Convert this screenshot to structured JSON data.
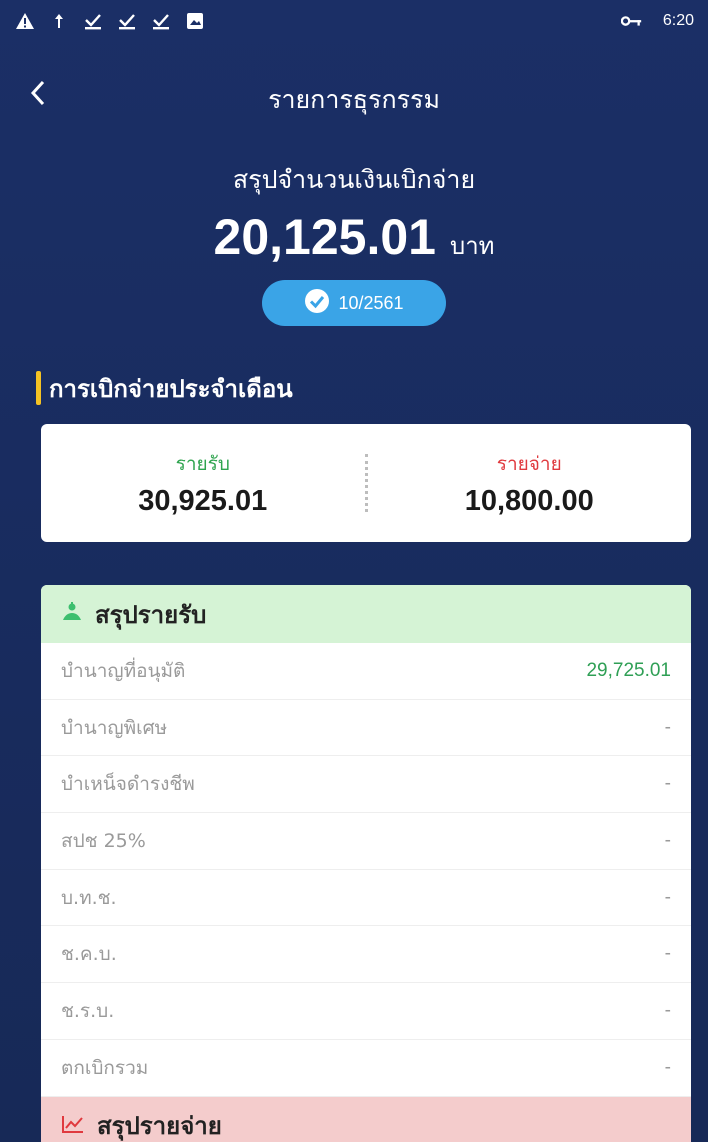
{
  "status_bar": {
    "time": "6:20",
    "icons": [
      "warning-icon",
      "upload-icon",
      "download-done-icon",
      "download-done-icon",
      "download-done-icon",
      "image-icon",
      "vpn-key-icon"
    ]
  },
  "header": {
    "title": "รายการธุรกรรม"
  },
  "summary": {
    "label": "สรุปจำนวนเงินเบิกจ่าย",
    "amount": "20,125.01",
    "unit": "บาท",
    "period": "10/2561"
  },
  "monthly": {
    "title": "การเบิกจ่ายประจำเดือน",
    "income_label": "รายรับ",
    "income_value": "30,925.01",
    "expense_label": "รายจ่าย",
    "expense_value": "10,800.00"
  },
  "income_summary": {
    "title": "สรุปรายรับ",
    "rows": [
      {
        "label": "บำนาญที่อนุมัติ",
        "value": "29,725.01"
      },
      {
        "label": "บำนาญพิเศษ",
        "value": "-"
      },
      {
        "label": "บำเหน็จดำรงชีพ",
        "value": "-"
      },
      {
        "label": "สปช 25%",
        "value": "-"
      },
      {
        "label": "บ.ท.ช.",
        "value": "-"
      },
      {
        "label": "ช.ค.บ.",
        "value": "-"
      },
      {
        "label": "ช.ร.บ.",
        "value": "-"
      },
      {
        "label": "ตกเบิกรวม",
        "value": "-"
      }
    ]
  },
  "expense_summary": {
    "title": "สรุปรายจ่าย"
  },
  "colors": {
    "background": "#1b2f66",
    "badge": "#3aa4e7",
    "accent_bar": "#f5c324",
    "income": "#2fa44f",
    "expense": "#e0393e",
    "income_header": "#d5f3d5",
    "expense_header": "#f4cccc"
  }
}
